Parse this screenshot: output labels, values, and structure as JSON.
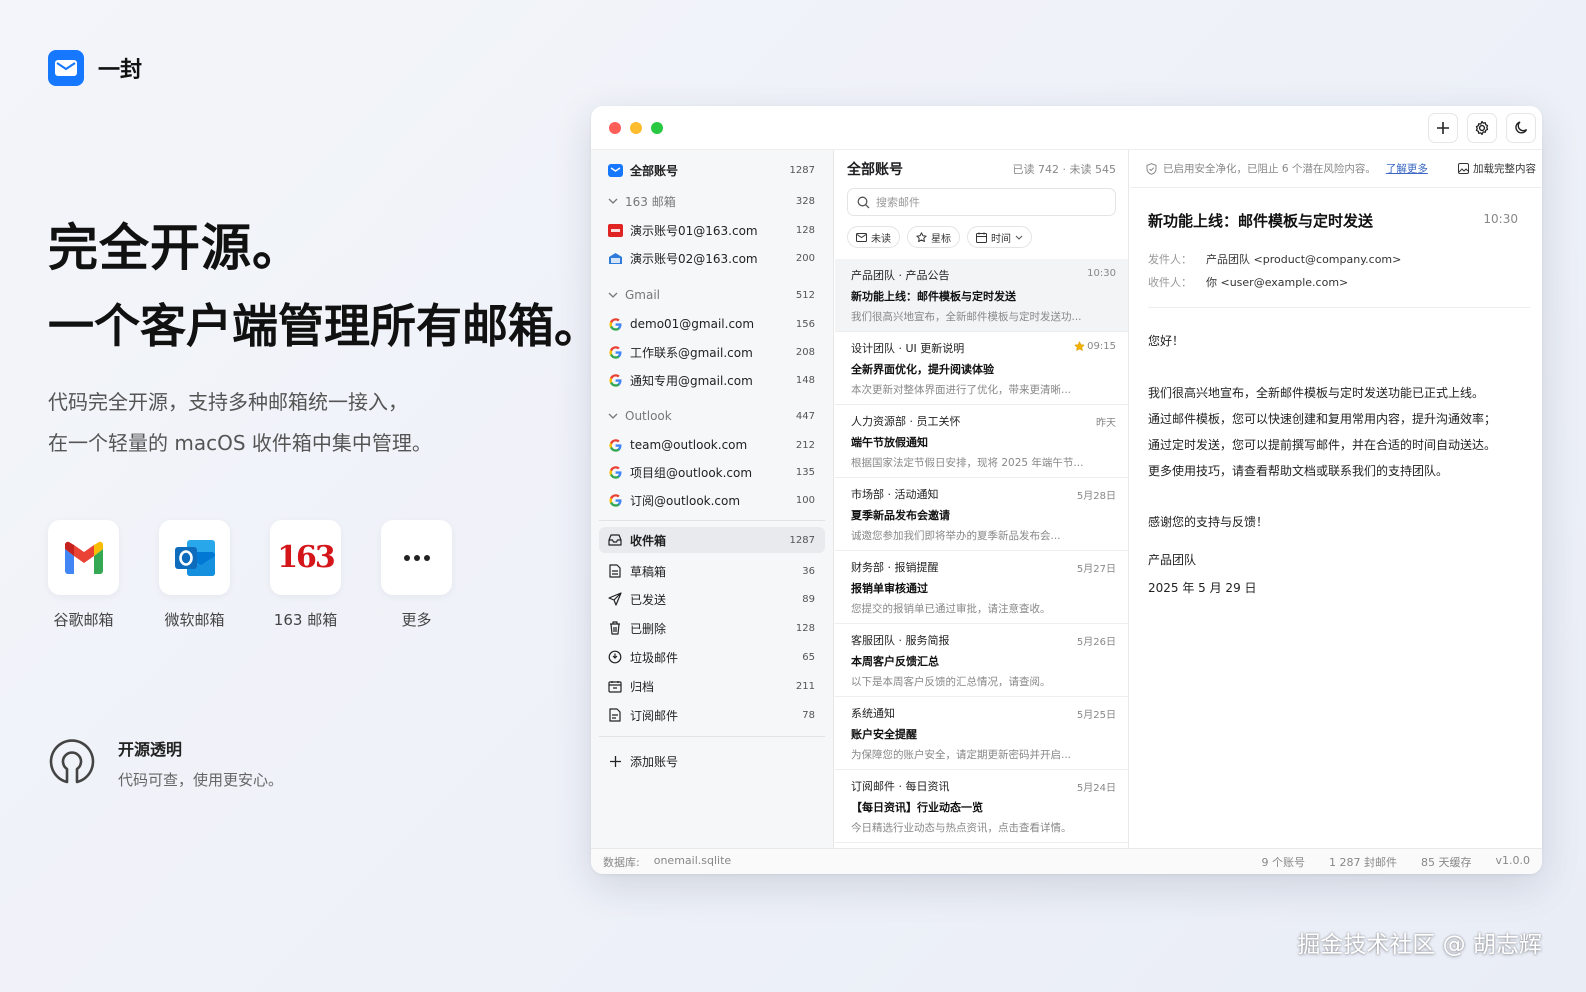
{
  "brand": {
    "name": "一封"
  },
  "hero": {
    "line1": "完全开源。",
    "line2": "一个客户端管理所有邮箱。"
  },
  "description": {
    "line1": "代码完全开源，支持多种邮箱统一接入，",
    "line2": "在一个轻量的 macOS 收件箱中集中管理。"
  },
  "providers": [
    {
      "label": "谷歌邮箱",
      "icon": "gmail-icon"
    },
    {
      "label": "微软邮箱",
      "icon": "outlook-icon"
    },
    {
      "label": "163 邮箱",
      "icon": "163-icon",
      "logo_text": "163"
    },
    {
      "label": "更多",
      "icon": "more-icon"
    }
  ],
  "open_source": {
    "title": "开源透明",
    "subtitle": "代码可查，使用更安心。"
  },
  "watermark": "掘金技术社区 @ 胡志辉",
  "window": {
    "traffic_lights": [
      "#ff5f57",
      "#febc2e",
      "#28c840"
    ],
    "toolbar": [
      "plus-icon",
      "gear-icon",
      "moon-icon"
    ],
    "sidebar": {
      "all_accounts": {
        "label": "全部账号",
        "count": "1287"
      },
      "groups": [
        {
          "name": "163 邮箱",
          "count": "328",
          "accounts": [
            {
              "label": "演示账号01@163.com",
              "count": "128"
            },
            {
              "label": "演示账号02@163.com",
              "count": "200"
            }
          ]
        },
        {
          "name": "Gmail",
          "count": "512",
          "accounts": [
            {
              "label": "demo01@gmail.com",
              "count": "156"
            },
            {
              "label": "工作联系@gmail.com",
              "count": "208"
            },
            {
              "label": "通知专用@gmail.com",
              "count": "148"
            }
          ]
        },
        {
          "name": "Outlook",
          "count": "447",
          "accounts": [
            {
              "label": "team@outlook.com",
              "count": "212"
            },
            {
              "label": "项目组@outlook.com",
              "count": "135"
            },
            {
              "label": "订阅@outlook.com",
              "count": "100"
            }
          ]
        }
      ],
      "folders": [
        {
          "label": "收件箱",
          "count": "1287",
          "icon": "inbox-icon"
        },
        {
          "label": "草稿箱",
          "count": "36",
          "icon": "draft-icon"
        },
        {
          "label": "已发送",
          "count": "89",
          "icon": "send-icon"
        },
        {
          "label": "已删除",
          "count": "128",
          "icon": "trash-icon"
        },
        {
          "label": "垃圾邮件",
          "count": "65",
          "icon": "spam-icon"
        },
        {
          "label": "归档",
          "count": "211",
          "icon": "archive-icon"
        },
        {
          "label": "订阅邮件",
          "count": "78",
          "icon": "subscription-icon"
        }
      ],
      "add_account": "添加账号"
    },
    "list": {
      "title": "全部账号",
      "stats": "已读 742 · 未读 545",
      "search_placeholder": "搜索邮件",
      "filters": [
        "未读",
        "星标",
        "时间"
      ],
      "mails": [
        {
          "from": "产品团队 · 产品公告",
          "time": "10:30",
          "subject": "新功能上线：邮件模板与定时发送",
          "preview": "我们很高兴地宣布，全新邮件模板与定时发送功...",
          "starred": false
        },
        {
          "from": "设计团队 · UI 更新说明",
          "time": "09:15",
          "subject": "全新界面优化，提升阅读体验",
          "preview": "本次更新对整体界面进行了优化，带来更清晰...",
          "starred": true
        },
        {
          "from": "人力资源部 · 员工关怀",
          "time": "昨天",
          "subject": "端午节放假通知",
          "preview": "根据国家法定节假日安排，现将 2025 年端午节...",
          "starred": false
        },
        {
          "from": "市场部 · 活动通知",
          "time": "5月28日",
          "subject": "夏季新品发布会邀请",
          "preview": "诚邀您参加我们即将举办的夏季新品发布会...",
          "starred": false
        },
        {
          "from": "财务部 · 报销提醒",
          "time": "5月27日",
          "subject": "报销单审核通过",
          "preview": "您提交的报销单已通过审批，请注意查收。",
          "starred": false
        },
        {
          "from": "客服团队 · 服务简报",
          "time": "5月26日",
          "subject": "本周客户反馈汇总",
          "preview": "以下是本周客户反馈的汇总情况，请查阅。",
          "starred": false
        },
        {
          "from": "系统通知",
          "time": "5月25日",
          "subject": "账户安全提醒",
          "preview": "为保障您的账户安全，请定期更新密码并开启...",
          "starred": false
        },
        {
          "from": "订阅邮件 · 每日资讯",
          "time": "5月24日",
          "subject": "【每日资讯】行业动态一览",
          "preview": "今日精选行业动态与热点资讯，点击查看详情。",
          "starred": false
        }
      ]
    },
    "reader": {
      "safety_notice": "已启用安全净化，已阻止 6 个潜在风险内容。",
      "learn_more": "了解更多",
      "load_full": "加载完整内容",
      "subject": "新功能上线：邮件模板与定时发送",
      "time": "10:30",
      "from_label": "发件人：",
      "from_value": "产品团队 <product@company.com>",
      "to_label": "收件人：",
      "to_value": "你 <user@example.com>",
      "greeting": "您好！",
      "body": [
        "我们很高兴地宣布，全新邮件模板与定时发送功能已正式上线。",
        "通过邮件模板，您可以快速创建和复用常用内容，提升沟通效率；",
        "通过定时发送，您可以提前撰写邮件，并在合适的时间自动送达。",
        "更多使用技巧，请查看帮助文档或联系我们的支持团队。"
      ],
      "thanks": "感谢您的支持与反馈！",
      "signature": "产品团队",
      "date": "2025 年 5 月 29 日"
    },
    "statusbar": {
      "db_label": "数据库:",
      "db_value": "onemail.sqlite",
      "accounts": "9 个账号",
      "mails": "1 287 封邮件",
      "cache": "85 天缓存",
      "version": "v1.0.0"
    }
  }
}
